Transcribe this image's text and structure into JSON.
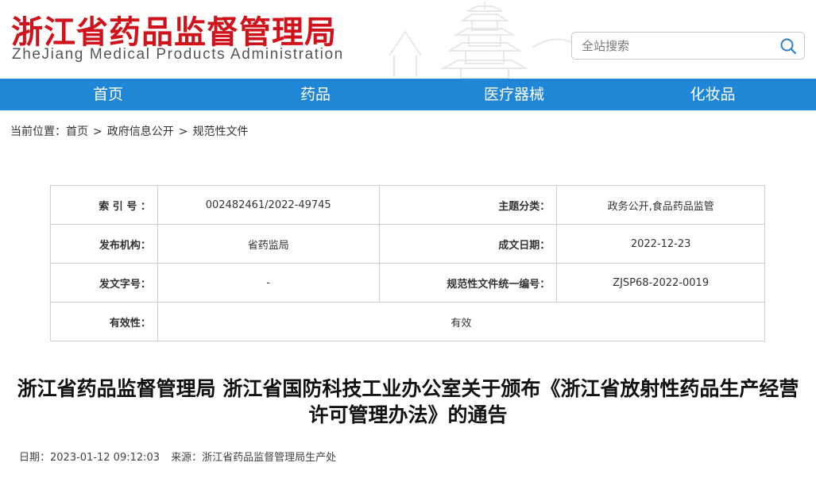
{
  "header": {
    "title": "浙江省药品监督管理局",
    "subtitle": "ZheJiang Medical Products Administration",
    "search_placeholder": "全站搜索",
    "search_icon": "search-icon",
    "title_color": "#d0121b"
  },
  "nav": {
    "items": [
      {
        "label": "首页"
      },
      {
        "label": "药品"
      },
      {
        "label": "医疗器械"
      },
      {
        "label": "化妆品"
      }
    ],
    "color": "#1f87d6"
  },
  "breadcrumb": {
    "prefix": "当前位置：",
    "items": [
      "首页",
      "政府信息公开",
      "规范性文件"
    ],
    "separator": ">"
  },
  "meta": {
    "index_label": "索 引 号 ：",
    "index_value": "002482461/2022-49745",
    "topic_label": "主题分类：",
    "topic_value": "政务公开,食品药品监管",
    "org_label": "发布机构：",
    "org_value": "省药监局",
    "date_label": "成文日期：",
    "date_value": "2022-12-23",
    "docno_label": "发文字号：",
    "docno_value": "-",
    "code_label": "规范性文件统一编号：",
    "code_value": "ZJSP68-2022-0019",
    "validity_label": "有效性：",
    "validity_value": "有效"
  },
  "document": {
    "title": "浙江省药品监督管理局 浙江省国防科技工业办公室关于颁布《浙江省放射性药品生产经营许可管理办法》的通告",
    "date_text": "日期：2023-01-12 09:12:03",
    "source_text": "来源：浙江省药品监督管理局生产处"
  }
}
